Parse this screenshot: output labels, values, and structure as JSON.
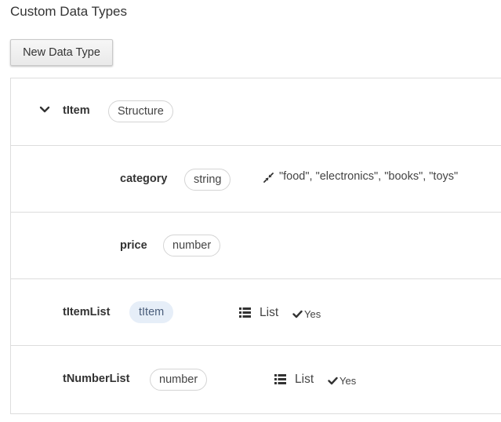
{
  "page": {
    "title": "Custom Data Types"
  },
  "toolbar": {
    "new_label": "New Data Type"
  },
  "rows": [
    {
      "name": "tItem",
      "type": "Structure",
      "expanded": true
    },
    {
      "name": "category",
      "type": "string",
      "enum": "\"food\", \"electronics\", \"books\", \"toys\""
    },
    {
      "name": "price",
      "type": "number"
    },
    {
      "name": "tItemList",
      "type": "tItem",
      "kind": "List",
      "required": "Yes"
    },
    {
      "name": "tNumberList",
      "type": "number",
      "kind": "List",
      "required": "Yes"
    }
  ],
  "icons": {
    "expand": "chevron-down-icon",
    "enum": "compress-arrows-icon",
    "list": "list-icon",
    "check": "check-icon"
  },
  "colors": {
    "border": "#dddddd",
    "pill_border": "#d4d4d4",
    "pill_highlight_bg": "#e6eef8",
    "text": "#333333"
  }
}
